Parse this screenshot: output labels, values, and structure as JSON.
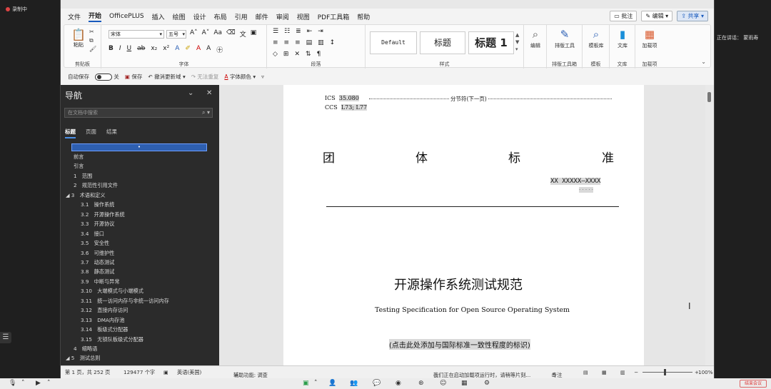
{
  "meeting": {
    "recording_label": "录制中",
    "speaking_label": "正在讲话：",
    "speaker_name": "蒙雨寿",
    "end_button": "结束会议"
  },
  "menu": {
    "tabs": [
      "文件",
      "开始",
      "OfficePLUS",
      "插入",
      "绘图",
      "设计",
      "布局",
      "引用",
      "邮件",
      "审阅",
      "视图",
      "PDF工具箱",
      "帮助"
    ],
    "active_tab": "开始",
    "comment": "批注",
    "edit": "编辑",
    "share": "共享"
  },
  "ribbon": {
    "clipboard": {
      "paste": "粘贴",
      "label": "剪贴板"
    },
    "font": {
      "name": "宋体",
      "size": "五号",
      "label": "字体"
    },
    "paragraph": {
      "label": "段落"
    },
    "styles": {
      "s1": "Default",
      "s2": "标题",
      "s3": "标题 1",
      "label": "样式"
    },
    "editing": {
      "label": "编辑"
    },
    "typeset": {
      "btn": "排版工具",
      "label": "排版工具箱"
    },
    "template": {
      "btn": "模板库",
      "label": "模板"
    },
    "library": {
      "btn": "文库",
      "label": "文库"
    },
    "addin": {
      "btn": "加载项",
      "label": "加载项"
    }
  },
  "qat": {
    "autosave": "自动保存",
    "autosave_state": "关",
    "save": "保存",
    "undo": "撤消更新域",
    "redo": "无法重复",
    "font_color": "字体颜色"
  },
  "nav": {
    "title": "导航",
    "search_placeholder": "在文档中搜索",
    "tabs": [
      "标题",
      "页面",
      "结果"
    ],
    "items": [
      {
        "text": "前言"
      },
      {
        "text": "引言"
      },
      {
        "text": "1　范围"
      },
      {
        "text": "2　规范性引用文件"
      },
      {
        "text": "◢ 3　术语和定义"
      },
      {
        "text": "3.1　操作系统"
      },
      {
        "text": "3.2　开源操作系统"
      },
      {
        "text": "3.3　开源协议"
      },
      {
        "text": "3.4　接口"
      },
      {
        "text": "3.5　安全性"
      },
      {
        "text": "3.6　可维护性"
      },
      {
        "text": "3.7　动态测试"
      },
      {
        "text": "3.8　静态测试"
      },
      {
        "text": "3.9　中断与异常"
      },
      {
        "text": "3.10　大端模式与小端模式"
      },
      {
        "text": "3.11　统一访问内存与非统一访问内存"
      },
      {
        "text": "3.12　直接内存访问"
      },
      {
        "text": "3.13　DMA内存池"
      },
      {
        "text": "3.14　板级式分配器"
      },
      {
        "text": "3.15　无锁队板级式分配器"
      },
      {
        "text": "4　缩略语"
      },
      {
        "text": "◢ 5　测试总则"
      }
    ]
  },
  "doc": {
    "ics_label": "ICS",
    "ics_value": "35.080",
    "ccs_label": "CCS",
    "ccs_value": "L73; L77",
    "section_break": "分节符(下一页)",
    "group_chars": [
      "团",
      "体",
      "标",
      "准"
    ],
    "std_no": "XX XXXXX—XXXX",
    "std_dots": "· · · · ·",
    "title_cn": "开源操作系统测试规范",
    "title_en": "Testing Specification for Open Source Operating System",
    "consistency": "(点击此处添加与国际标准一致性程度的标识)"
  },
  "status": {
    "page": "第 1 页，共 252 页",
    "words": "129477 个字",
    "lang": "英语(美国)",
    "accessibility": "辅助功能: 调查",
    "loading": "我们正在启动加载项运行时，请稍等片刻...",
    "focus": "专注",
    "zoom": "100%"
  }
}
